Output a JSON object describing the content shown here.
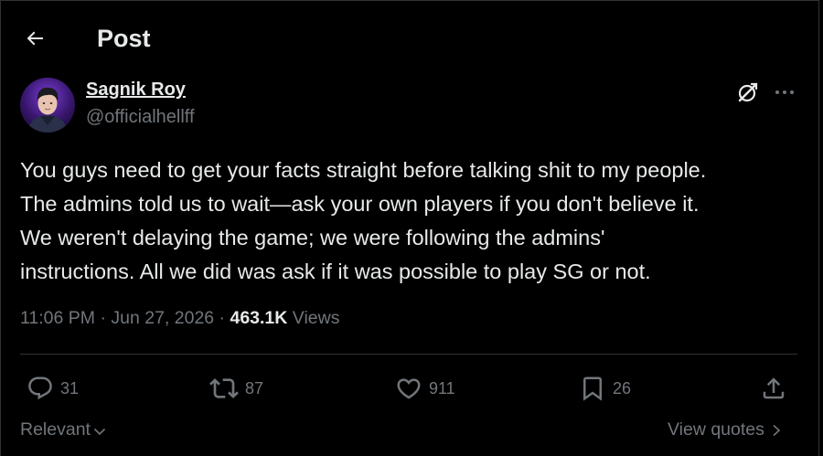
{
  "header": {
    "title": "Post",
    "back_icon": "arrow-left-icon"
  },
  "author": {
    "name": "Sagnik Roy",
    "handle": "@officialhellff",
    "avatar": "avatar-image"
  },
  "tweet": {
    "text": "You guys need to get your facts straight before talking shit to my people.\nThe admins told us to wait—ask your own players if you don't believe it.\nWe weren't delaying the game; we were following the admins'\ninstructions. All we did was ask if it was possible to play SG or not.",
    "time": "11:06 PM",
    "separator": " · ",
    "date": "Jun 27, 2026",
    "views_count": "463.1K",
    "views_label": "Views"
  },
  "actions": {
    "replies": "31",
    "reposts": "87",
    "likes": "911",
    "bookmarks": "26"
  },
  "footer": {
    "sort_label": "Relevant",
    "view_quotes_label": "View quotes"
  },
  "colors": {
    "background": "#000000",
    "text_primary": "#e7e9ea",
    "text_secondary": "#71767b",
    "divider": "#2f3336"
  }
}
